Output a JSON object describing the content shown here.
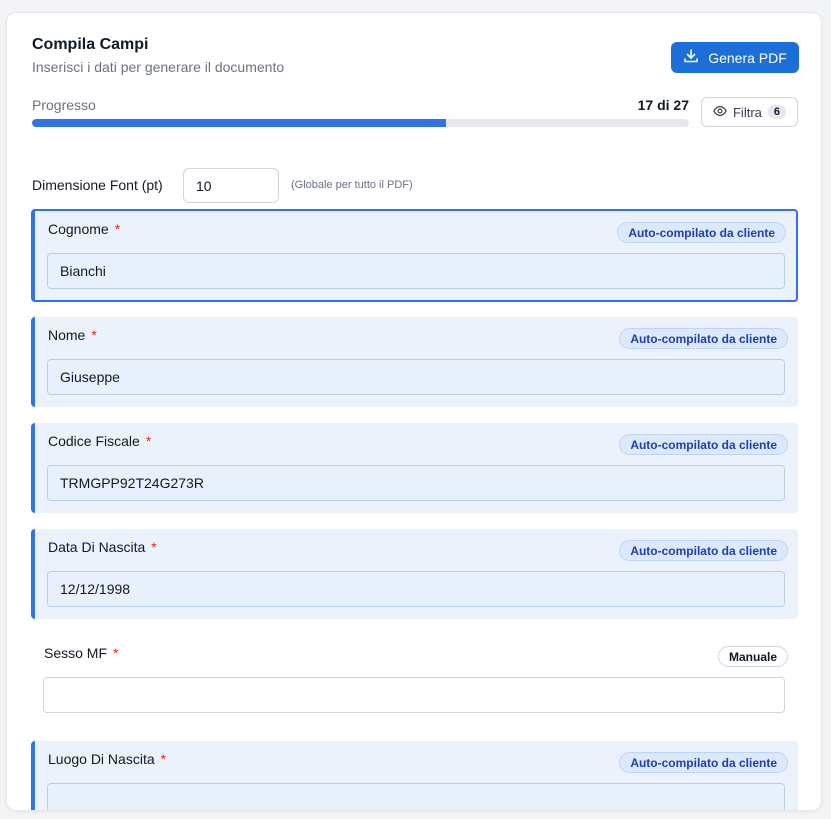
{
  "header": {
    "title": "Compila Campi",
    "subtitle": "Inserisci i dati per generare il documento",
    "generate_label": "Genera PDF"
  },
  "progress": {
    "label": "Progresso",
    "count_text": "17 di 27",
    "completed": 17,
    "total": 27
  },
  "filter": {
    "label": "Filtra",
    "count": "6"
  },
  "font_size": {
    "label": "Dimensione Font (pt)",
    "value": "10",
    "hint": "(Globale per tutto il PDF)"
  },
  "fields": [
    {
      "label": "Cognome",
      "required": "*",
      "tag": "Auto-compilato da cliente",
      "value": "Bianchi",
      "mode": "auto"
    },
    {
      "label": "Nome",
      "required": "*",
      "tag": "Auto-compilato da cliente",
      "value": "Giuseppe",
      "mode": "auto"
    },
    {
      "label": "Codice Fiscale",
      "required": "*",
      "tag": "Auto-compilato da cliente",
      "value": "TRMGPP92T24G273R",
      "mode": "auto"
    },
    {
      "label": "Data Di Nascita",
      "required": "*",
      "tag": "Auto-compilato da cliente",
      "value": "12/12/1998",
      "mode": "auto"
    },
    {
      "label": "Sesso MF",
      "required": "*",
      "tag": "Manuale",
      "value": "",
      "mode": "manual"
    },
    {
      "label": "Luogo Di Nascita",
      "required": "*",
      "tag": "Auto-compilato da cliente",
      "value": "",
      "mode": "auto"
    }
  ],
  "colors": {
    "accent": "#2f73e4",
    "button": "#1c6fd9",
    "auto_field_bg": "#ebf2fc",
    "required": "#dc2626"
  },
  "icons": {
    "generate": "download-icon",
    "filter": "eye-icon"
  }
}
